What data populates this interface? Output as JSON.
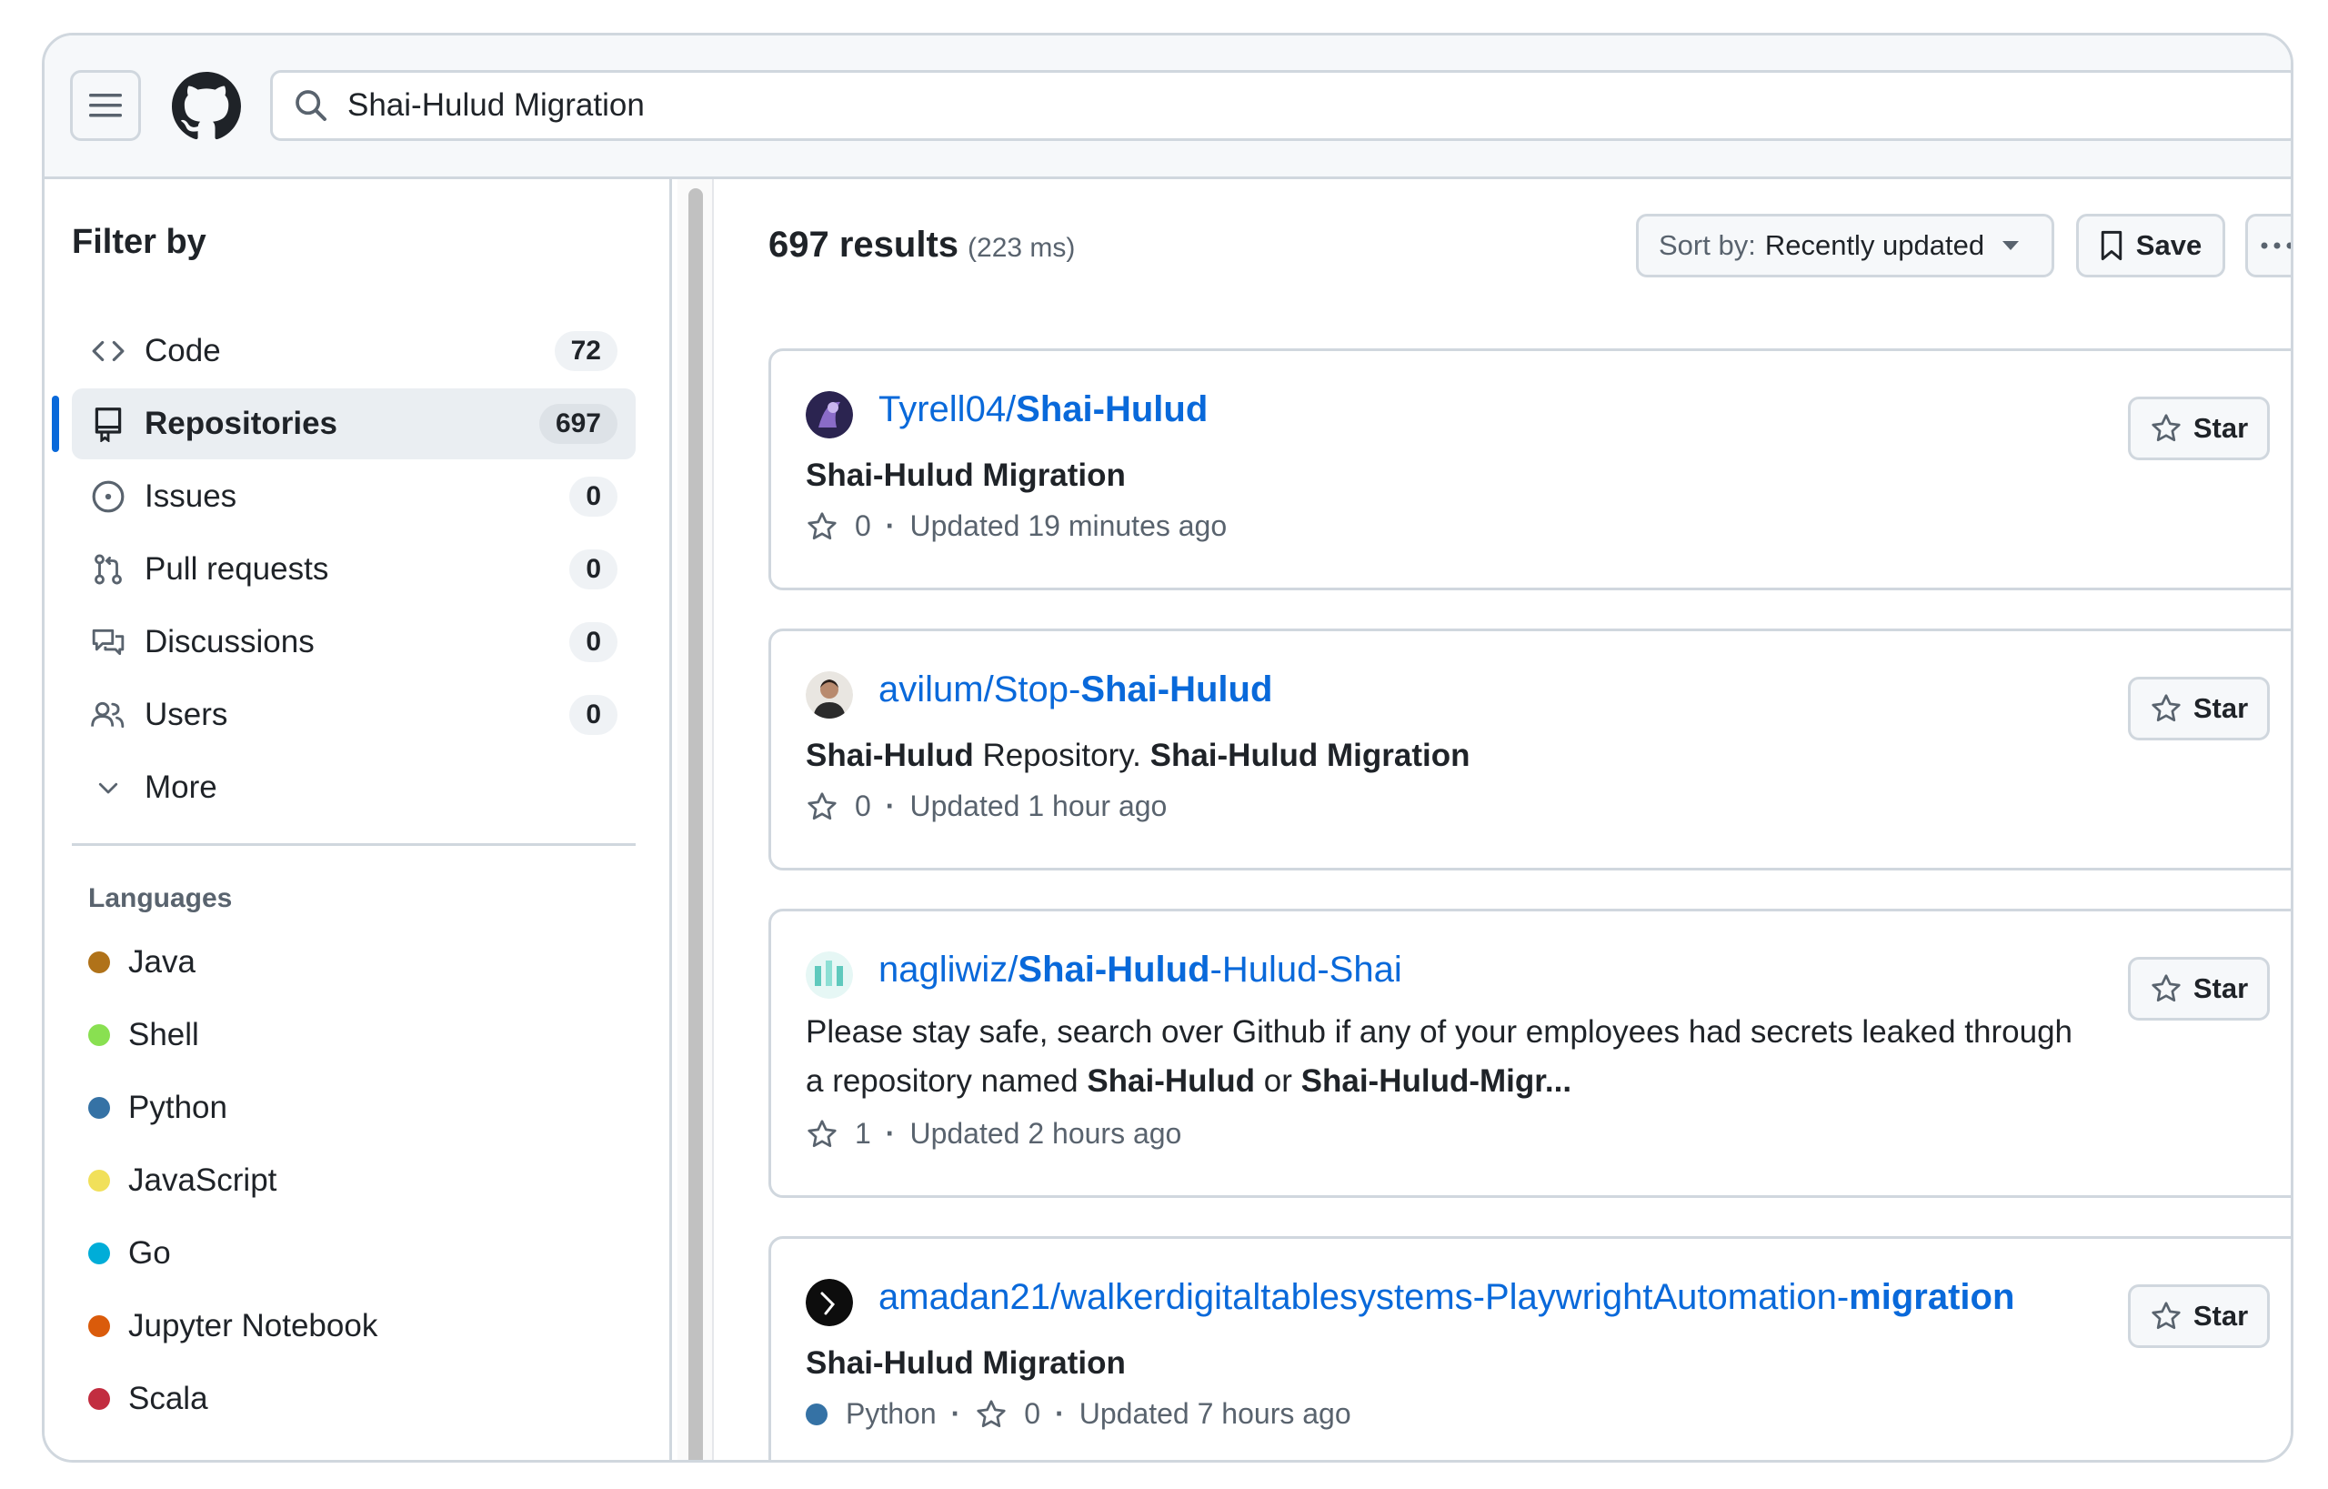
{
  "search": {
    "value": "Shai-Hulud Migration"
  },
  "sidebar": {
    "title": "Filter by",
    "items": [
      {
        "label": "Code",
        "count": "72"
      },
      {
        "label": "Repositories",
        "count": "697"
      },
      {
        "label": "Issues",
        "count": "0"
      },
      {
        "label": "Pull requests",
        "count": "0"
      },
      {
        "label": "Discussions",
        "count": "0"
      },
      {
        "label": "Users",
        "count": "0"
      },
      {
        "label": "More"
      }
    ],
    "languages_title": "Languages",
    "languages": [
      {
        "label": "Java",
        "color": "#b07219"
      },
      {
        "label": "Shell",
        "color": "#89e051"
      },
      {
        "label": "Python",
        "color": "#3572a5"
      },
      {
        "label": "JavaScript",
        "color": "#f1e05a"
      },
      {
        "label": "Go",
        "color": "#00add8"
      },
      {
        "label": "Jupyter Notebook",
        "color": "#da5b0b"
      },
      {
        "label": "Scala",
        "color": "#c22d40"
      }
    ]
  },
  "results": {
    "count": "697 results",
    "time": "(223 ms)",
    "sort_prefix": "Sort by:",
    "sort_value": "Recently updated",
    "save_label": "Save"
  },
  "cards": [
    {
      "owner": "Tyrell04/",
      "name": "Shai-Hulud",
      "desc": "Shai-Hulud Migration",
      "stars": "0",
      "updated": "Updated 19 minutes ago",
      "star_label": "Star"
    },
    {
      "owner": "avilum/Stop-",
      "name": "Shai-Hulud",
      "desc_b1": "Shai-Hulud",
      "desc_t1": " Repository. ",
      "desc_b2": "Shai-Hulud Migration",
      "stars": "0",
      "updated": "Updated 1 hour ago",
      "star_label": "Star"
    },
    {
      "owner": "nagliwiz/",
      "name": "Shai-Hulud",
      "suffix": "-Hulud-Shai",
      "desc_t1": "Please stay safe, search over Github if any of your employees had secrets leaked through a repository named ",
      "desc_b1": "Shai-Hulud",
      "desc_t2": " or ",
      "desc_b2": "Shai-Hulud-Migr...",
      "stars": "1",
      "updated": "Updated 2 hours ago",
      "star_label": "Star"
    },
    {
      "owner": "amadan21/walkerdigitaltablesystems-PlaywrightAutomation-",
      "name": "migration",
      "desc": "Shai-Hulud Migration",
      "language": "Python",
      "language_color": "#3572a5",
      "stars": "0",
      "updated": "Updated 7 hours ago",
      "star_label": "Star"
    }
  ]
}
